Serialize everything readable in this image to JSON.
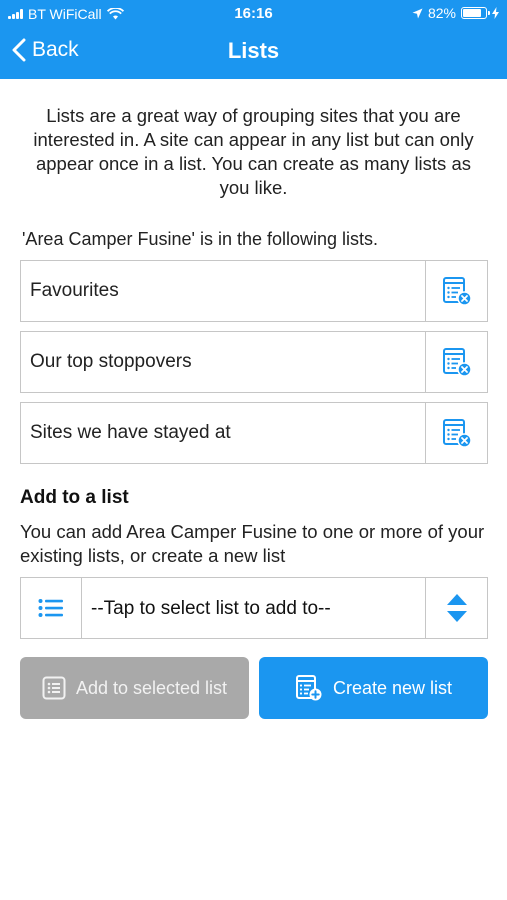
{
  "status_bar": {
    "carrier": "BT WiFiCall",
    "time": "16:16",
    "battery": "82%",
    "battery_level": 0.82
  },
  "nav": {
    "back_label": "Back",
    "title": "Lists"
  },
  "intro_text": "Lists are a great way of grouping sites that you are interested in. A site can appear in any list but can only appear once in a list. You can create as many lists as you like.",
  "membership_label": "'Area Camper Fusine' is in the following lists.",
  "lists": [
    {
      "name": "Favourites",
      "action_icon": "list-remove-icon"
    },
    {
      "name": "Our top stoppovers",
      "action_icon": "list-remove-icon"
    },
    {
      "name": "Sites we have stayed at",
      "action_icon": "list-remove-icon"
    }
  ],
  "add_section": {
    "heading": "Add to a list",
    "description": "You can add Area Camper Fusine to one or more of your existing lists, or create a new list",
    "selector_text": "--Tap to select list to add to--"
  },
  "buttons": {
    "add_label": "Add to selected list",
    "create_label": "Create new list"
  },
  "colors": {
    "accent": "#1b96f0",
    "disabled": "#a9a9a9",
    "border": "#c6c6c6"
  }
}
